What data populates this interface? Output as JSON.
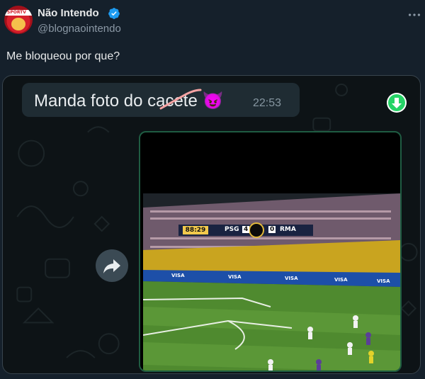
{
  "tweet": {
    "author_name": "Não Intendo",
    "handle": "@blognaointendo",
    "text": "Me bloqueou por que?",
    "verified_icon": "verified-badge-icon",
    "more_icon": "more-options-icon",
    "avatar_banner": "SPORTV"
  },
  "media": {
    "message_text": "Manda foto do cacete",
    "message_emoji": "😈",
    "message_time": "22:53",
    "download_icon": "download-icon",
    "forward_icon": "forward-icon",
    "scoreboard": {
      "clock": "88:29",
      "team1": "PSG",
      "score1": "4",
      "score2": "0",
      "team2": "RMA"
    },
    "ad_boards": [
      "VISA",
      "VISA",
      "VISA",
      "VISA",
      "VISA"
    ]
  },
  "colors": {
    "background": "#15202b",
    "verified": "#1d9bf0",
    "download": "#25d366",
    "bubble": "#1f2c33"
  }
}
